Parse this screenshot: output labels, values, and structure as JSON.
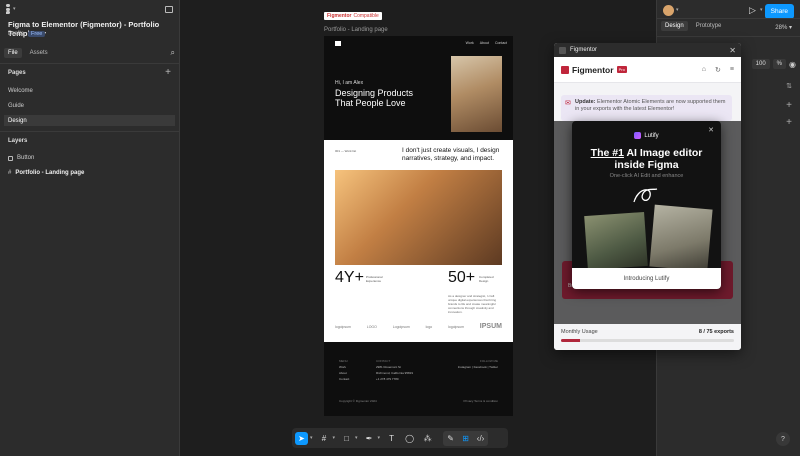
{
  "left_panel": {
    "file_title": "Figma to Elementor (Figmentor) - Portfolio Templa...",
    "drafts": "Drafts",
    "plan_badge": "Free",
    "tabs": [
      "File",
      "Assets"
    ],
    "pages_header": "Pages",
    "pages": [
      "Welcome",
      "Guide",
      "Design"
    ],
    "layers_header": "Layers",
    "layers": [
      "Button",
      "Portfolio - Landing page"
    ]
  },
  "right_panel": {
    "share_label": "Share",
    "tabs": [
      "Design",
      "Prototype"
    ],
    "zoom": "28%",
    "opacity_value": "100",
    "opacity_unit": "%",
    "help_label": "?"
  },
  "canvas": {
    "badge_brand": "Figmentor",
    "badge_text": "Compatible",
    "frame_label": "Portfolio - Landing page",
    "nav": [
      "Work",
      "About",
      "Contact"
    ],
    "greeting": "Hi, I am Alex",
    "headline": "Designing Products That People Love",
    "tag": "001 — Work list",
    "intro": "I don't just create visuals, I design narratives, strategy, and impact.",
    "stat1_num": "4Y+",
    "stat1_label": "Professional Experience",
    "stat2_num": "50+",
    "stat2_label": "Completed Design",
    "bio": "As a designer and strategist, I craft unique digital experiences that bring brands to life and create meaningful connections through creativity and innovation.",
    "logos": [
      "logoipsum",
      "LOGO",
      "Logoipsum",
      "logo",
      "logoipsum",
      "IPSUM"
    ],
    "footer_menu_head": "MENU",
    "footer_menu": [
      "Work",
      "About",
      "Contact"
    ],
    "footer_contact_head": "CONTACT",
    "footer_contact": [
      "2981 Rosemont St",
      "Richmond, California 95819",
      "+1 278 479 7780"
    ],
    "footer_follow_head": "FOLLOW ME",
    "footer_follow": "Instagram | Facebook | Twitter",
    "copyright": "Copyright © Figmentor 2024",
    "legal": "Privacy     Terms & condition"
  },
  "plugin": {
    "title": "Figmentor",
    "brand": "Figmentor",
    "pro_badge": "Pro",
    "update_label": "Update:",
    "update_text": "Elementor Atomic Elements are now supported them in your exports with the latest Elementor!",
    "dim_text": "Browser.",
    "usage_label": "Monthly Usage",
    "usage_value": "8 / 75 exports",
    "usage_fraction": 0.107,
    "accent": "#b0273c"
  },
  "lutify": {
    "brand": "Lutify",
    "headline_1": "The #1",
    "headline_2": "AI Image editor",
    "headline_3": "inside Figma",
    "sub": "One-click AI Edit and enhance",
    "cta": "Introducing Lutify",
    "close": "✕"
  },
  "toolbar": {
    "tools": [
      "move-tool",
      "frame-tool",
      "shape-tool",
      "pen-tool",
      "text-tool",
      "comment-tool",
      "actions-tool",
      "draw-mode",
      "design-mode",
      "dev-mode"
    ]
  }
}
